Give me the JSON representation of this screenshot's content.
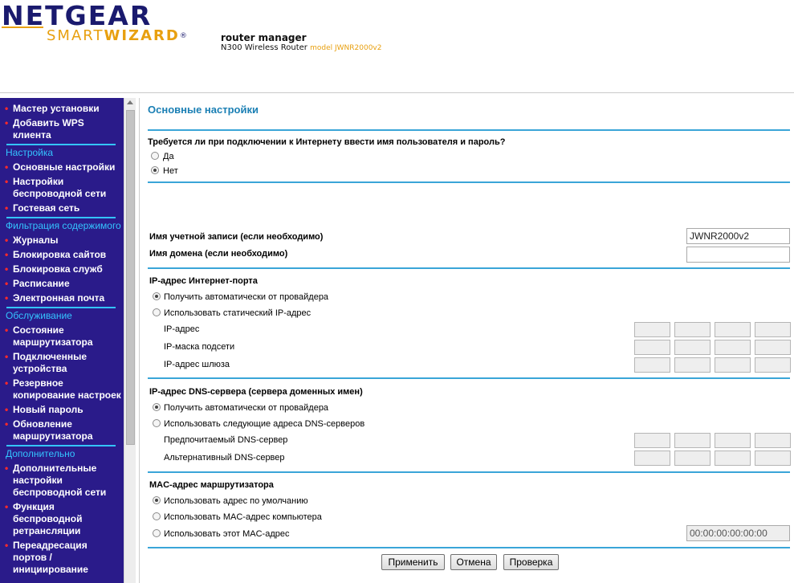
{
  "header": {
    "brand": "NETGEAR",
    "brand_sub_light": "SMART",
    "brand_sub_bold": "WIZARD",
    "brand_reg": "®",
    "product_title": "router manager",
    "product_name": "N300 Wireless Router",
    "product_model": "model JWNR2000v2"
  },
  "sidebar": {
    "items": [
      {
        "type": "link",
        "label": "Мастер установки"
      },
      {
        "type": "link",
        "label": "Добавить WPS клиента"
      },
      {
        "type": "section",
        "label": "Настройка"
      },
      {
        "type": "link",
        "label": "Основные настройки"
      },
      {
        "type": "link",
        "label": "Настройки беспроводной сети"
      },
      {
        "type": "link",
        "label": "Гостевая сеть"
      },
      {
        "type": "section",
        "label": "Фильтрация содержимого"
      },
      {
        "type": "link",
        "label": "Журналы"
      },
      {
        "type": "link",
        "label": "Блокировка сайтов"
      },
      {
        "type": "link",
        "label": "Блокировка служб"
      },
      {
        "type": "link",
        "label": "Расписание"
      },
      {
        "type": "link",
        "label": "Электронная почта"
      },
      {
        "type": "section",
        "label": "Обслуживание"
      },
      {
        "type": "link",
        "label": "Состояние маршрутизатора"
      },
      {
        "type": "link",
        "label": "Подключенные устройства"
      },
      {
        "type": "link",
        "label": "Резервное копирование настроек"
      },
      {
        "type": "link",
        "label": "Новый пароль"
      },
      {
        "type": "link",
        "label": "Обновление маршрутизатора"
      },
      {
        "type": "section",
        "label": "Дополнительно"
      },
      {
        "type": "link",
        "label": "Дополнительные настройки беспроводной сети"
      },
      {
        "type": "link",
        "label": "Функция беспроводной ретрансляции"
      },
      {
        "type": "link",
        "label": "Переадресация портов / инициирование"
      }
    ]
  },
  "main": {
    "title": "Основные настройки",
    "login_question": "Требуется ли при подключении к Интернету ввести имя пользователя и пароль?",
    "login_yes": "Да",
    "login_no": "Нет",
    "account_label": "Имя учетной записи (если необходимо)",
    "account_value": "JWNR2000v2",
    "domain_label": "Имя домена  (если необходимо)",
    "domain_value": "",
    "ip_section": "IP-адрес Интернет-порта",
    "ip_auto": "Получить автоматически от провайдера",
    "ip_static": "Использовать статический IP-адрес",
    "ip_address": "IP-адрес",
    "ip_mask": "IP-маска подсети",
    "ip_gateway": "IP-адрес шлюза",
    "dns_section": "IP-адрес DNS-сервера (сервера доменных имен)",
    "dns_auto": "Получить автоматически от провайдера",
    "dns_manual": "Использовать следующие адреса DNS-серверов",
    "dns_primary": "Предпочитаемый DNS-сервер",
    "dns_secondary": "Альтернативный DNS-сервер",
    "mac_section": "MAC-адрес маршрутизатора",
    "mac_default": "Использовать адрес по умолчанию",
    "mac_computer": "Использовать MAC-адрес компьютера",
    "mac_custom": "Использовать этот MAC-адрес",
    "mac_value": "00:00:00:00:00:00"
  },
  "buttons": {
    "apply": "Применить",
    "cancel": "Отмена",
    "test": "Проверка"
  }
}
